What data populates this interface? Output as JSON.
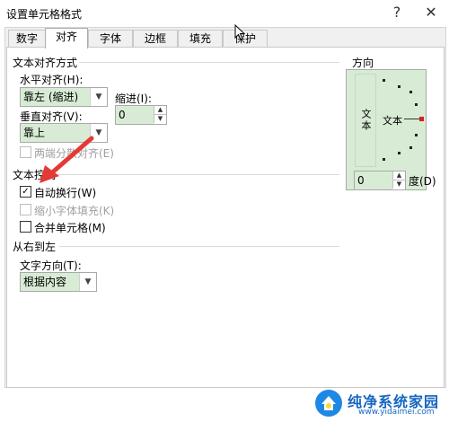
{
  "window": {
    "title": "设置单元格格式",
    "help_icon": "?",
    "close_icon": "✕"
  },
  "tabs": [
    {
      "label": "数字"
    },
    {
      "label": "对齐",
      "active": true
    },
    {
      "label": "字体"
    },
    {
      "label": "边框"
    },
    {
      "label": "填充"
    },
    {
      "label": "保护"
    }
  ],
  "text_alignment": {
    "group_label": "文本对齐方式",
    "horizontal_label": "水平对齐(H):",
    "horizontal_value": "靠左 (缩进)",
    "indent_label": "缩进(I):",
    "indent_value": "0",
    "vertical_label": "垂直对齐(V):",
    "vertical_value": "靠上",
    "justify_distributed_label": "两端分散对齐(E)"
  },
  "text_control": {
    "group_label": "文本控制",
    "wrap_text_label": "自动换行(W)",
    "wrap_text_checked": true,
    "shrink_to_fit_label": "缩小字体填充(K)",
    "merge_cells_label": "合并单元格(M)"
  },
  "right_to_left": {
    "group_label": "从右到左",
    "direction_label": "文字方向(T):",
    "direction_value": "根据内容"
  },
  "orientation": {
    "group_label": "方向",
    "vertical_text": "文本",
    "angled_text": "文本",
    "degrees_value": "0",
    "degrees_label": "度(D)"
  },
  "watermark": {
    "name": "纯净系统家园",
    "url": "www.yidaimei.com"
  },
  "colors": {
    "accent_green": "#d8ecd5",
    "arrow_red": "#e53935"
  }
}
